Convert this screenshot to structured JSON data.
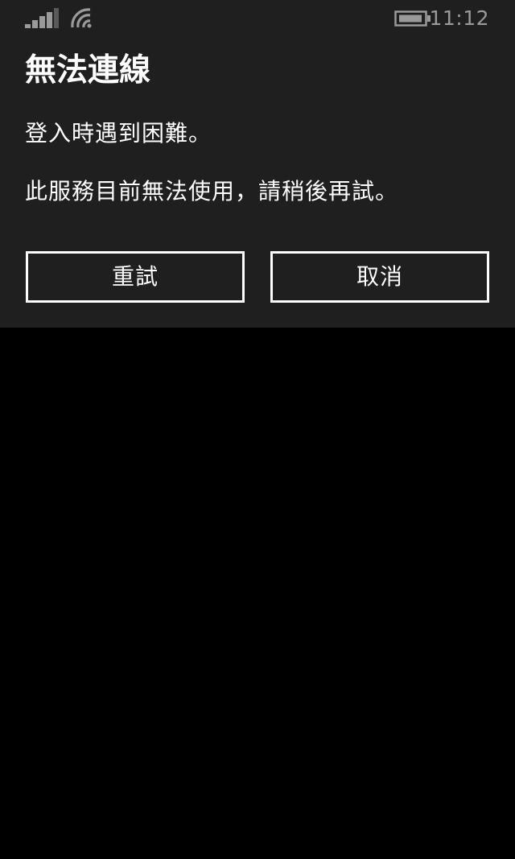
{
  "status_bar": {
    "time": "11:12",
    "icons": [
      "signal-strength-icon",
      "wifi-icon",
      "battery-icon"
    ]
  },
  "dialog": {
    "title": "無法連線",
    "message_1": "登入時遇到困難。",
    "message_2": "此服務目前無法使用，請稍後再試。",
    "retry_label": "重試",
    "cancel_label": "取消"
  },
  "colors": {
    "dialog_background": "#1f1f1f",
    "screen_background": "#000000",
    "text": "#ffffff",
    "status_text": "#9a9a9a"
  }
}
